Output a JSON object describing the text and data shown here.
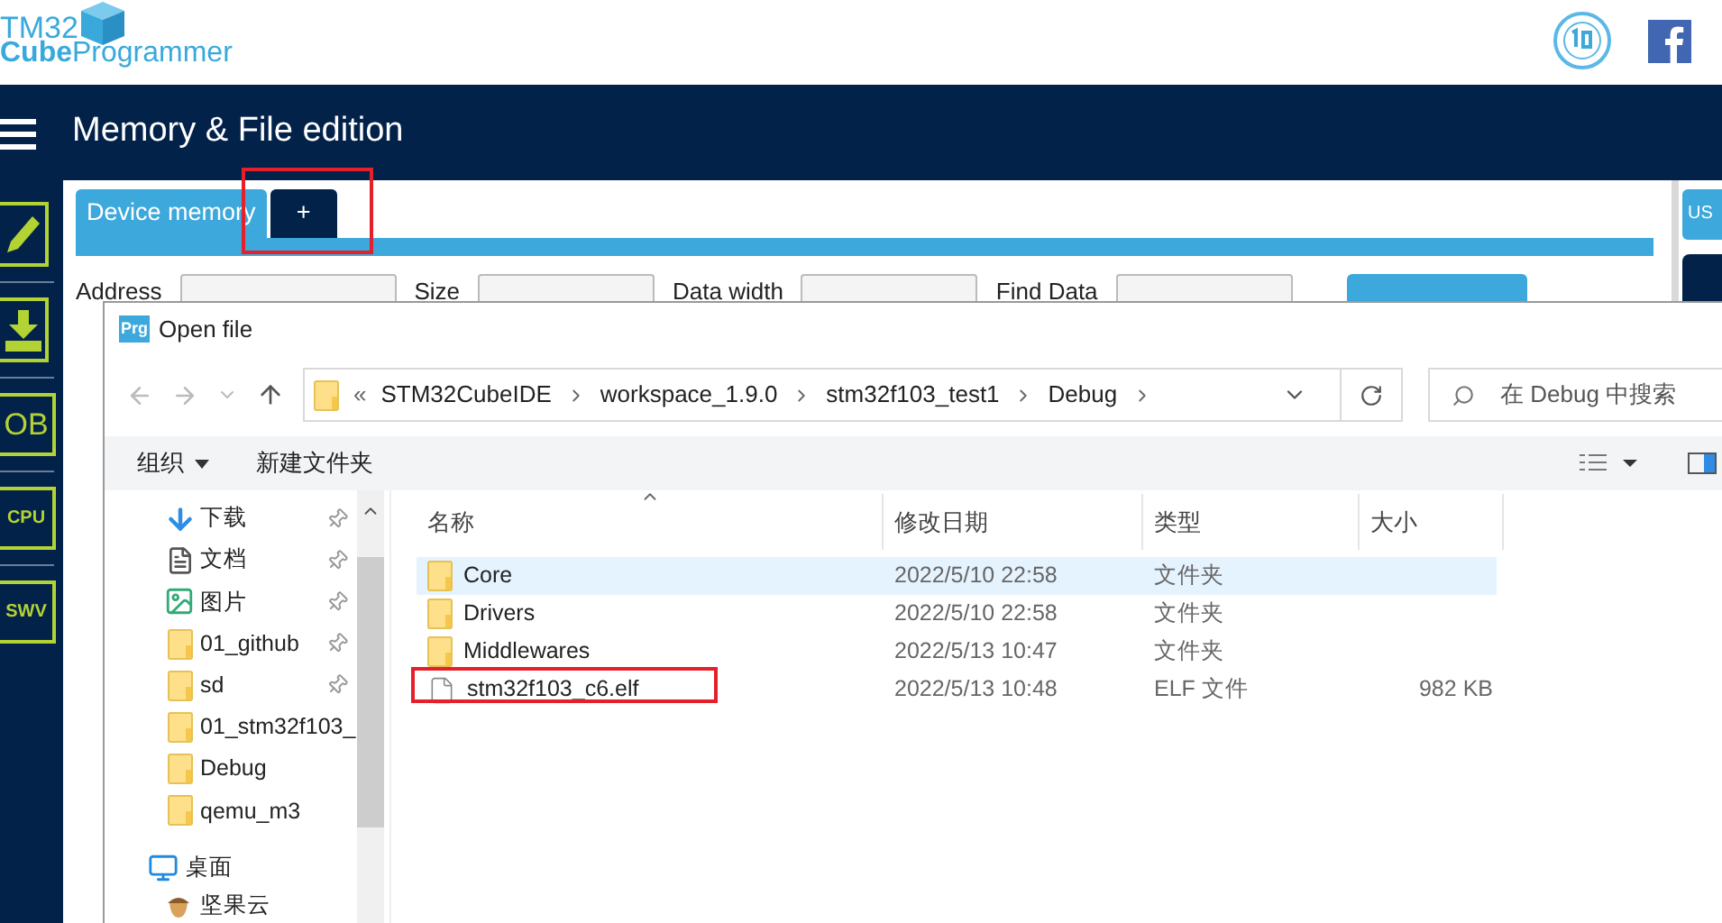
{
  "header": {
    "logo": {
      "top": "TM32",
      "bold": "Cube",
      "rest": "Programmer"
    }
  },
  "nav_bar": {
    "title": "Memory & File edition"
  },
  "sidebar": {
    "labels": [
      "OB",
      "CPU",
      "SWV"
    ]
  },
  "tabs": [
    {
      "label": "Device memory",
      "selected": true
    },
    {
      "label": "+",
      "selected": false
    }
  ],
  "toolbar": {
    "labels": [
      "Address",
      "Size",
      "Data width",
      "Find Data"
    ]
  },
  "right_panel": {
    "tab": "US"
  },
  "dialog": {
    "title": "Open file",
    "app_icon": "Prg",
    "breadcrumb": {
      "overflow": "«",
      "parts": [
        "STM32CubeIDE",
        "workspace_1.9.0",
        "stm32f103_test1",
        "Debug"
      ]
    },
    "search": {
      "placeholder": "在 Debug 中搜索"
    },
    "toolbar": {
      "organize": "组织",
      "new_folder": "新建文件夹"
    },
    "nav_pane": {
      "quick_access": [
        {
          "label": "下载",
          "kind": "download",
          "pinned": true
        },
        {
          "label": "文档",
          "kind": "document",
          "pinned": true
        },
        {
          "label": "图片",
          "kind": "picture",
          "pinned": true
        },
        {
          "label": "01_github",
          "kind": "folder",
          "pinned": true
        },
        {
          "label": "sd",
          "kind": "folder",
          "pinned": true
        },
        {
          "label": "01_stm32f103_",
          "kind": "folder",
          "pinned": false
        },
        {
          "label": "Debug",
          "kind": "folder",
          "pinned": false
        },
        {
          "label": "qemu_m3",
          "kind": "folder",
          "pinned": false
        }
      ],
      "locations": [
        {
          "label": "桌面",
          "kind": "desktop",
          "children": [
            {
              "label": "坚果云",
              "kind": "cloud"
            }
          ]
        }
      ]
    },
    "files": {
      "columns": [
        "名称",
        "修改日期",
        "类型",
        "大小"
      ],
      "rows": [
        {
          "name": "Core",
          "date": "2022/5/10 22:58",
          "type": "文件夹",
          "size": "",
          "kind": "folder",
          "selected": true
        },
        {
          "name": "Drivers",
          "date": "2022/5/10 22:58",
          "type": "文件夹",
          "kind": "folder",
          "selected": false
        },
        {
          "name": "Middlewares",
          "date": "2022/5/13 10:47",
          "type": "文件夹",
          "kind": "folder",
          "selected": false
        },
        {
          "name": "stm32f103_c6.elf",
          "date": "2022/5/13 10:48",
          "type": "ELF 文件",
          "size": "982 KB",
          "kind": "file",
          "selected": false
        }
      ]
    }
  }
}
